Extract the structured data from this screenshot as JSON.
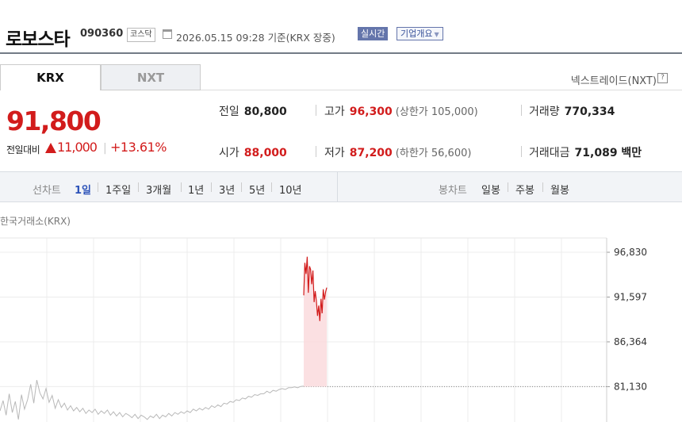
{
  "header": {
    "name": "로보스타",
    "code": "090360",
    "market": "코스닥",
    "datetime": "2026.05.15 09:28",
    "basis": "기준(KRX 장중)",
    "realtime_label": "실시간",
    "company_info_label": "기업개요"
  },
  "tabs": [
    {
      "label": "KRX"
    },
    {
      "label": "NXT"
    }
  ],
  "nxt_link": "넥스트레이드(NXT)",
  "help_glyph": "?",
  "quote": {
    "price": "91,800",
    "change_label": "전일대비",
    "change_amount": "11,000",
    "change_sep": "|",
    "change_percent": "+13.61%"
  },
  "stats": {
    "prev_close": {
      "label": "전일",
      "value": "80,800"
    },
    "high": {
      "label": "고가",
      "value": "96,300",
      "sub": "(상한가 105,000)"
    },
    "volume": {
      "label": "거래량",
      "value": "770,334"
    },
    "open": {
      "label": "시가",
      "value": "88,000"
    },
    "low": {
      "label": "저가",
      "value": "87,200",
      "sub": "(하한가 56,600)"
    },
    "amount": {
      "label": "거래대금",
      "value": "71,089 백만"
    }
  },
  "toolbar": {
    "line_label": "선차트",
    "periods": [
      "1일",
      "1주일",
      "3개월",
      "1년",
      "3년",
      "5년",
      "10년"
    ],
    "candle_label": "봉차트",
    "candles": [
      "일봉",
      "주봉",
      "월봉"
    ]
  },
  "chart_source": "한국거래소(KRX)",
  "colors": {
    "up": "#d21c1c",
    "accent": "#2d53b9",
    "gray_line": "#b8b8b8",
    "fill": "#fadadd"
  },
  "chart_data": {
    "type": "line",
    "y_ticks": [
      96830,
      91597,
      86364,
      81130
    ],
    "y_tick_labels": [
      "96,830",
      "91,597",
      "86,364",
      "81,130"
    ],
    "baseline": 81130,
    "ylim": [
      77000,
      98500
    ],
    "n_points": 100,
    "series": [
      {
        "values": [
          78300,
          79500,
          77800,
          80300,
          78100,
          79400,
          77300,
          80200,
          78500,
          79600,
          81400,
          79200,
          81900,
          80400,
          79700,
          80900,
          79300,
          80100,
          78600,
          79600,
          78700,
          79200,
          78400,
          78900,
          78300,
          78700,
          78200,
          78600,
          78000,
          78400,
          78100,
          78500,
          77900,
          78300,
          78000,
          78400,
          77800,
          78200,
          77700,
          78100,
          77600,
          78000,
          77800,
          77500,
          77900,
          77400,
          77800,
          77600,
          77300,
          77700,
          77500,
          77900,
          77400,
          77800,
          77600,
          78000,
          77700,
          78100,
          77900,
          78200,
          78000,
          78300,
          78100,
          78500,
          78300,
          78600,
          78400,
          78700,
          78500,
          78900,
          78700,
          79000,
          78800,
          79200,
          79100,
          79400,
          79300,
          79600,
          79500,
          79800,
          79700,
          80000,
          79900,
          80200,
          80100,
          80300,
          80300,
          80600,
          80400,
          80700,
          80600,
          80800,
          80900,
          80800,
          81000,
          81000,
          81100,
          81000,
          81150,
          81200
        ]
      },
      {
        "values": [
          91800,
          95600,
          94300,
          96300,
          92100,
          95200,
          94800,
          93100,
          94700,
          91000,
          92300,
          91200,
          89400,
          90600,
          88800,
          91400,
          89700,
          92500,
          91300,
          92200,
          92700
        ]
      }
    ]
  }
}
